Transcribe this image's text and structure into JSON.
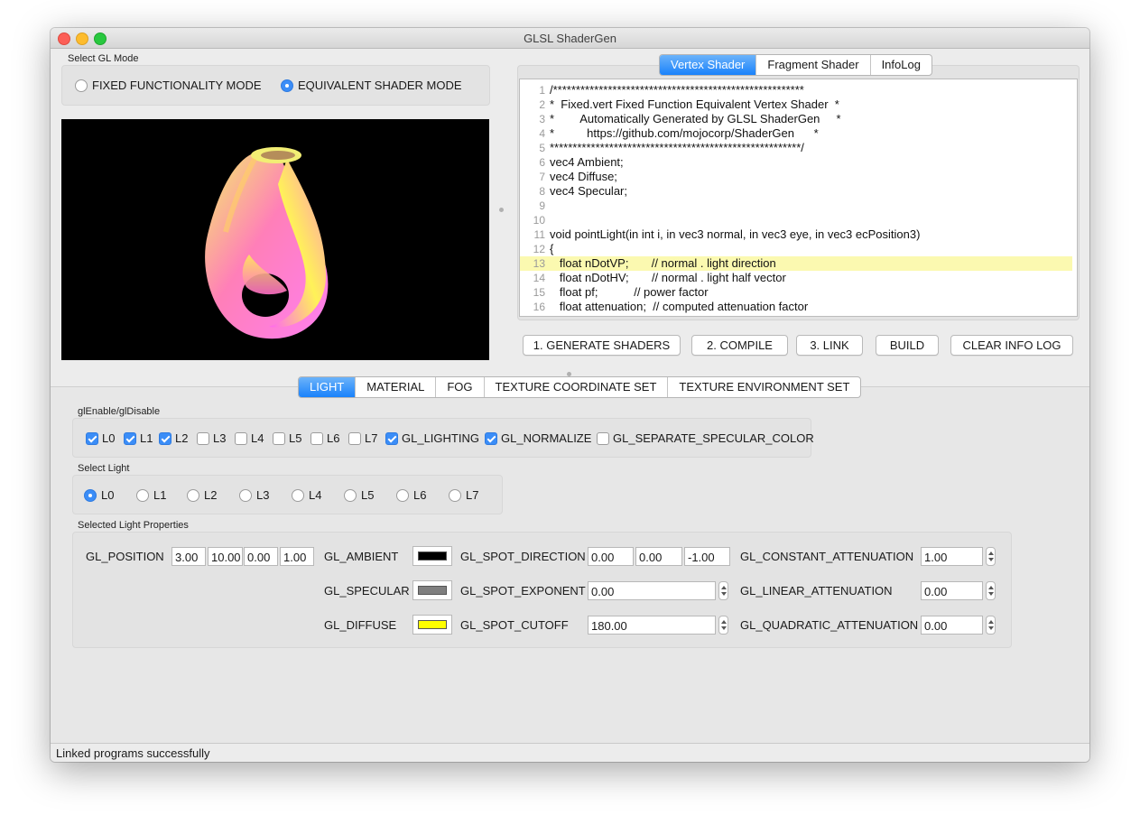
{
  "window": {
    "title": "GLSL ShaderGen"
  },
  "gl_mode": {
    "label": "Select GL Mode",
    "options": [
      {
        "label": "FIXED FUNCTIONALITY MODE",
        "selected": false
      },
      {
        "label": "EQUIVALENT SHADER MODE",
        "selected": true
      }
    ]
  },
  "shader_tabs": [
    {
      "label": "Vertex Shader",
      "active": true
    },
    {
      "label": "Fragment Shader",
      "active": false
    },
    {
      "label": "InfoLog",
      "active": false
    }
  ],
  "code": {
    "highlight_line": 13,
    "lines": [
      {
        "n": "1",
        "text": "/*******************************************************"
      },
      {
        "n": "2",
        "text": "*  Fixed.vert Fixed Function Equivalent Vertex Shader  *"
      },
      {
        "n": "3",
        "text": "*        Automatically Generated by GLSL ShaderGen     *"
      },
      {
        "n": "4",
        "text": "*          https://github.com/mojocorp/ShaderGen      *"
      },
      {
        "n": "5",
        "text": "*******************************************************/"
      },
      {
        "n": "6",
        "text": "vec4 Ambient;"
      },
      {
        "n": "7",
        "text": "vec4 Diffuse;"
      },
      {
        "n": "8",
        "text": "vec4 Specular;"
      },
      {
        "n": "9",
        "text": ""
      },
      {
        "n": "10",
        "text": ""
      },
      {
        "n": "11",
        "text": "void pointLight(in int i, in vec3 normal, in vec3 eye, in vec3 ecPosition3)"
      },
      {
        "n": "12",
        "text": "{"
      },
      {
        "n": "13",
        "text": "   float nDotVP;       // normal . light direction"
      },
      {
        "n": "14",
        "text": "   float nDotHV;       // normal . light half vector"
      },
      {
        "n": "15",
        "text": "   float pf;           // power factor"
      },
      {
        "n": "16",
        "text": "   float attenuation;  // computed attenuation factor"
      }
    ]
  },
  "actions": {
    "generate": "1. GENERATE SHADERS",
    "compile": "2. COMPILE",
    "link": "3. LINK",
    "build": "BUILD",
    "clear": "CLEAR INFO LOG"
  },
  "property_tabs": [
    {
      "label": "LIGHT",
      "active": true
    },
    {
      "label": "MATERIAL",
      "active": false
    },
    {
      "label": "FOG",
      "active": false
    },
    {
      "label": "TEXTURE COORDINATE SET",
      "active": false
    },
    {
      "label": "TEXTURE ENVIRONMENT SET",
      "active": false
    }
  ],
  "enable": {
    "label": "glEnable/glDisable",
    "items": [
      {
        "label": "L0",
        "checked": true
      },
      {
        "label": "L1",
        "checked": true
      },
      {
        "label": "L2",
        "checked": true
      },
      {
        "label": "L3",
        "checked": false
      },
      {
        "label": "L4",
        "checked": false
      },
      {
        "label": "L5",
        "checked": false
      },
      {
        "label": "L6",
        "checked": false
      },
      {
        "label": "L7",
        "checked": false
      },
      {
        "label": "GL_LIGHTING",
        "checked": true
      },
      {
        "label": "GL_NORMALIZE",
        "checked": true
      },
      {
        "label": "GL_SEPARATE_SPECULAR_COLOR",
        "checked": false
      }
    ]
  },
  "select_light": {
    "label": "Select Light",
    "items": [
      {
        "label": "L0",
        "selected": true
      },
      {
        "label": "L1",
        "selected": false
      },
      {
        "label": "L2",
        "selected": false
      },
      {
        "label": "L3",
        "selected": false
      },
      {
        "label": "L4",
        "selected": false
      },
      {
        "label": "L5",
        "selected": false
      },
      {
        "label": "L6",
        "selected": false
      },
      {
        "label": "L7",
        "selected": false
      }
    ]
  },
  "props": {
    "label": "Selected Light Properties",
    "position": {
      "label": "GL_POSITION",
      "values": [
        "3.00",
        "10.00",
        "0.00",
        "1.00"
      ]
    },
    "ambient": {
      "label": "GL_AMBIENT",
      "color": "#000000"
    },
    "specular": {
      "label": "GL_SPECULAR",
      "color": "#7f7f7f"
    },
    "diffuse": {
      "label": "GL_DIFFUSE",
      "color": "#ffff00"
    },
    "spot_direction": {
      "label": "GL_SPOT_DIRECTION",
      "values": [
        "0.00",
        "0.00",
        "-1.00"
      ]
    },
    "spot_exponent": {
      "label": "GL_SPOT_EXPONENT",
      "value": "0.00"
    },
    "spot_cutoff": {
      "label": "GL_SPOT_CUTOFF",
      "value": "180.00"
    },
    "constant_att": {
      "label": "GL_CONSTANT_ATTENUATION",
      "value": "1.00"
    },
    "linear_att": {
      "label": "GL_LINEAR_ATTENUATION",
      "value": "0.00"
    },
    "quadratic_att": {
      "label": "GL_QUADRATIC_ATTENUATION",
      "value": "0.00"
    }
  },
  "status": "Linked programs successfully"
}
